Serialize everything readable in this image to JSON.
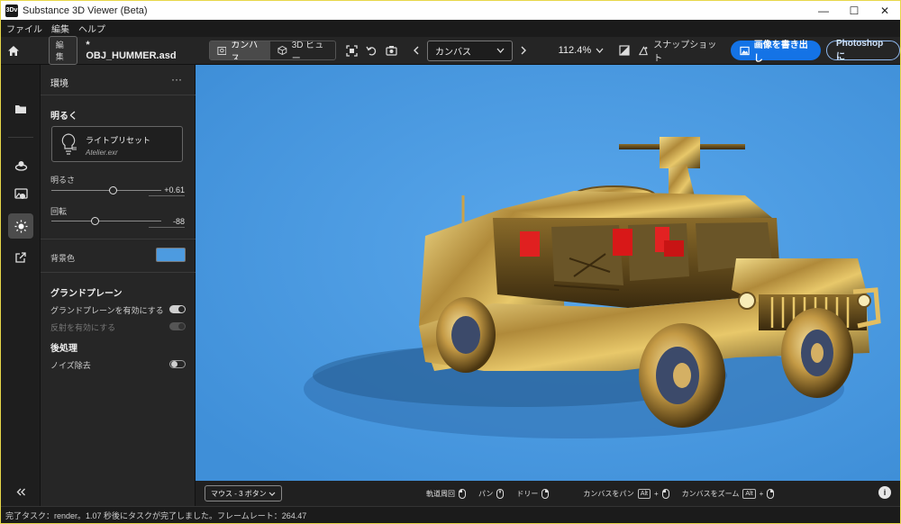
{
  "window": {
    "title": "Substance 3D Viewer (Beta)",
    "logo": "3Dv",
    "minimize": "—",
    "maximize": "☐",
    "close": "✕"
  },
  "menu": [
    "ファイル",
    "編集",
    "ヘルプ"
  ],
  "toolbar": {
    "edit_badge": "編集",
    "filename": "* OBJ_HUMMER.asd",
    "canvas_tab": "カンバス",
    "view3d_tab": "3D ビュー",
    "camera_select": "カンバス",
    "zoom": "112.4%",
    "snapshot": "スナップショット",
    "export_button": "画像を書き出し",
    "photoshop_button": "Photoshop に"
  },
  "panel": {
    "header": "環境",
    "more": "···",
    "section_lighting": "明るく",
    "preset_title": "ライトプリセット",
    "preset_file": "Atelier.exr",
    "brightness_label": "明るさ",
    "brightness_value": "+0.61",
    "brightness_pos": 0.56,
    "rotation_label": "回転",
    "rotation_value": "-88",
    "rotation_pos": 0.4,
    "bg_color_label": "背景色",
    "bg_color": "#4d9be0",
    "section_ground": "グランドプレーン",
    "ground_enable_label": "グランドプレーンを有効にする",
    "reflection_label": "反射を有効にする",
    "section_post": "後処理",
    "denoise_label": "ノイズ除去"
  },
  "viewport_bar": {
    "mouse_mode": "マウス - 3 ボタン",
    "orbit": "軌道周回",
    "pan": "パン",
    "dolly": "ドリー",
    "canvas_pan": "カンバスをパン",
    "canvas_zoom": "カンバスをズーム",
    "alt_key": "Alt",
    "plus": "+",
    "info": "i"
  },
  "status": "完了タスク：render。1.07 秒後にタスクが完了しました。フレームレート：264.47",
  "colors": {
    "accent": "#1473e6",
    "viewport_bg": "#4c9be1",
    "border": "#e8d84a"
  }
}
